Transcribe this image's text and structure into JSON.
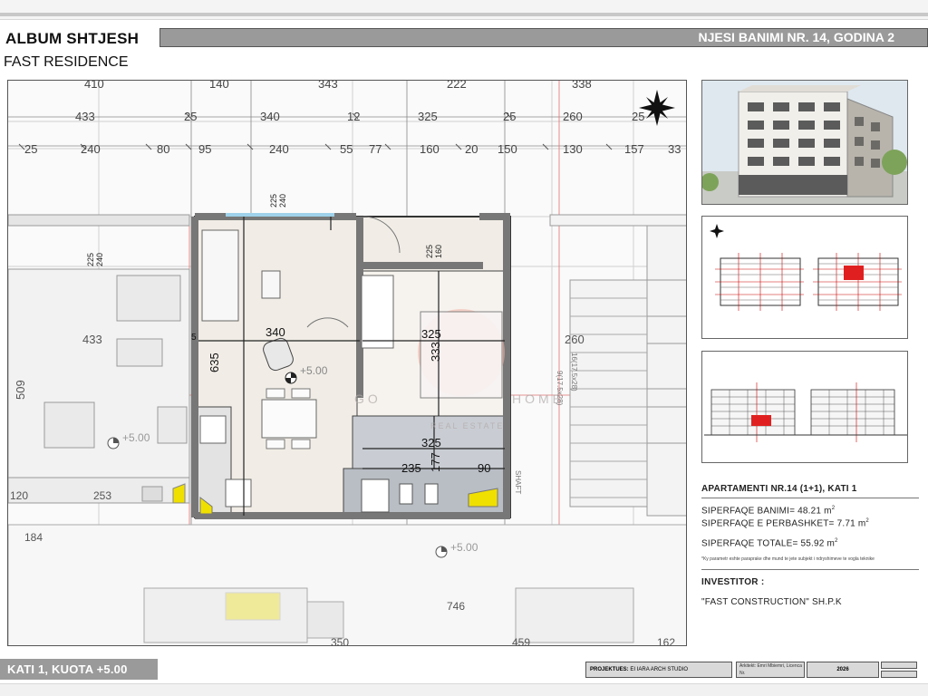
{
  "header": {
    "album_title": "ALBUM SHTJESH",
    "album_subtitle": "FAST RESIDENCE",
    "unit_title": "NJESI BANIMI NR. 14, GODINA 2"
  },
  "plan": {
    "dims_row1": [
      "410",
      "140",
      "343",
      "222",
      "338"
    ],
    "dims_row2": [
      "433",
      "25",
      "340",
      "12",
      "325",
      "25",
      "260",
      "25"
    ],
    "dims_row3": [
      "25",
      "240",
      "80",
      "95",
      "240",
      "55",
      "77",
      "160",
      "20",
      "150",
      "130",
      "157",
      "33"
    ],
    "room_dims": {
      "d240_225_top": [
        "240",
        "225"
      ],
      "d160_225": [
        "160",
        "225"
      ],
      "d240_225_left": [
        "240",
        "225"
      ],
      "d340": "340",
      "d635": "635",
      "d325_a": "325",
      "d333": "333",
      "d325_b": "325",
      "d235": "235",
      "d177": "177",
      "d90": "90",
      "d433": "433",
      "d509": "509",
      "d260": "260",
      "d120": "120",
      "d253": "253",
      "d184": "184",
      "d746": "746",
      "d350": "350",
      "d459": "459",
      "d162": "162",
      "d5": "5"
    },
    "level_main": "+5.00",
    "level_left": "+5.00",
    "level_bottom": "+5.00",
    "stair_note_1": "9(17.5x28)",
    "stair_note_2": "16(17.5x28)",
    "shaft_label": "SHAFT",
    "watermark_1": "GO",
    "watermark_2": "HOME",
    "watermark_3": "REAL ESTATE"
  },
  "apartment": {
    "title": "APARTAMENTI NR.14 (1+1), KATI 1",
    "area_living_label": "SIPERFAQE BANIMI=",
    "area_living_value": "48.21 m",
    "area_common_label": "SIPERFAQE E PERBASHKET=",
    "area_common_value": "7.71 m",
    "area_total_label": "SIPERFAQE TOTALE=",
    "area_total_value": "55.92 m",
    "sup": "2",
    "note": "*Ky parametr eshte paraprake dhe mund te jete subjekt i ndryshimeve te vogla teknike"
  },
  "investor": {
    "label": "INVESTITOR :",
    "value": "\"FAST CONSTRUCTION\" SH.P.K"
  },
  "footer": {
    "floor_label": "KATI 1, KUOTA +5.00",
    "project_label": "PROJEKTUES:",
    "project_value": "EI IARA ARCH STUDIO",
    "stamp_text": "Arkitekt: Emri Mbiemri, Licenca Nr.",
    "year": "2026"
  },
  "colors": {
    "banner": "#9a9a9a",
    "highlight_red": "#e02020",
    "yellow_fixture": "#f0e000",
    "unit_fill": "#f1ede6",
    "kitchen_fill": "#c9cdd3"
  }
}
